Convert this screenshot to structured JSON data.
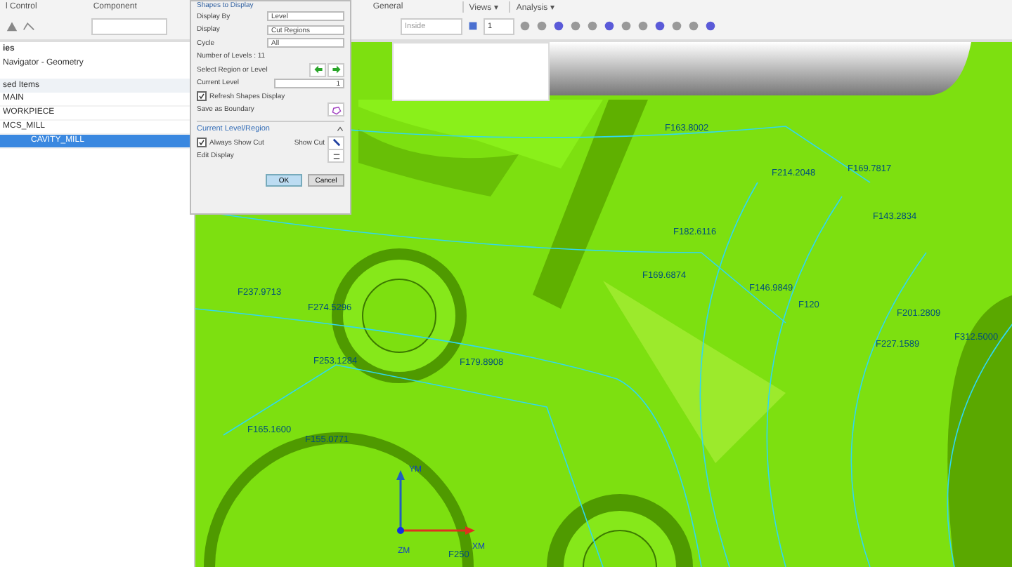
{
  "ribbon": {
    "groups": [
      "l Control",
      "Component",
      "General"
    ],
    "menus": [
      "Views ▾",
      "Analysis ▾"
    ]
  },
  "toolbar": {
    "filter_field": "Inside",
    "layer_field": "1"
  },
  "navigator": {
    "title_fragment": "ies",
    "title": "Navigator - Geometry",
    "column_header": "sed Items",
    "tree": [
      {
        "label": "MAIN",
        "selected": false
      },
      {
        "label": "WORKPIECE",
        "selected": false
      },
      {
        "label": "MCS_MILL",
        "selected": false,
        "children": [
          {
            "label": "CAVITY_MILL",
            "selected": true
          }
        ]
      }
    ]
  },
  "dialog": {
    "title": "Shapes to Display",
    "fields": [
      {
        "label": "Display By",
        "value": "Level"
      },
      {
        "label": "Display",
        "value": "Cut Regions"
      },
      {
        "label": "Cycle",
        "value": "All"
      }
    ],
    "levels_text": "Number of Levels : 11",
    "select_label": "Select Region or Level",
    "current_level": {
      "label": "Current Level",
      "value": "1"
    },
    "refresh": {
      "label": "Refresh Shapes Display",
      "checked": true
    },
    "save_label": "Save as Boundary",
    "section": {
      "title": "Current Level/Region",
      "expanded": true
    },
    "always_show_cut": {
      "label": "Always Show Cut",
      "checked": true
    },
    "show_cut_label": "Show Cut",
    "edit_label": "Edit Display",
    "buttons": [
      "OK",
      "Cancel"
    ]
  },
  "viewport": {
    "feed_labels": [
      "F163.8002",
      "F214.2048",
      "F169.7817",
      "F143.2834",
      "F182.6116",
      "F169.6874",
      "F146.9849",
      "F120",
      "F201.2809",
      "F227.1589",
      "F312.5000",
      "F237.9713",
      "F274.5296",
      "F253.1284",
      "F179.8908",
      "F165.1600",
      "F155.0771",
      "F250"
    ],
    "axes": [
      "YM",
      "XM",
      "ZM"
    ]
  }
}
